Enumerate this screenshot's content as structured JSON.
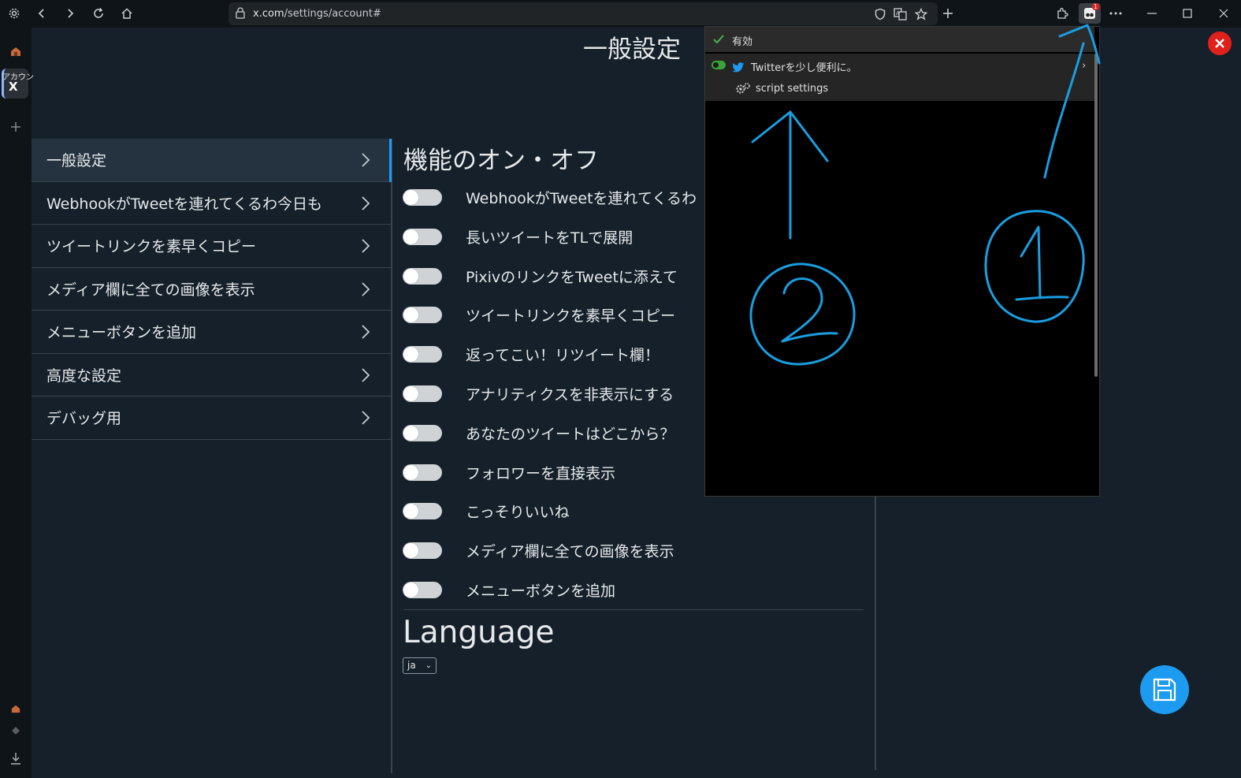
{
  "browser": {
    "url_host": "x.com",
    "url_path": "/settings/account#",
    "extension_badge": "1"
  },
  "sidebar": {
    "account_label": "アカウン",
    "account_icon": "X"
  },
  "page": {
    "title": "一般設定",
    "nav": [
      {
        "label": "一般設定"
      },
      {
        "label": "WebhookがTweetを連れてくるわ今日も"
      },
      {
        "label": "ツイートリンクを素早くコピー"
      },
      {
        "label": "メディア欄に全ての画像を表示"
      },
      {
        "label": "メニューボタンを追加"
      },
      {
        "label": "高度な設定"
      },
      {
        "label": "デバッグ用"
      }
    ],
    "section_title": "機能のオン・オフ",
    "toggles": [
      {
        "label": "WebhookがTweetを連れてくるわ"
      },
      {
        "label": "長いツイートをTLで展開"
      },
      {
        "label": "PixivのリンクをTweetに添えて"
      },
      {
        "label": "ツイートリンクを素早くコピー"
      },
      {
        "label": "返ってこい！リツイート欄！"
      },
      {
        "label": "アナリティクスを非表示にする"
      },
      {
        "label": "あなたのツイートはどこから？"
      },
      {
        "label": "フォロワーを直接表示"
      },
      {
        "label": "こっそりいいね"
      },
      {
        "label": "メディア欄に全ての画像を表示"
      },
      {
        "label": "メニューボタンを追加"
      }
    ],
    "language_title": "Language",
    "language_value": "ja"
  },
  "popup": {
    "enabled_label": "有効",
    "script_name": "Twitterを少し便利に。",
    "script_settings": "script settings"
  },
  "colors": {
    "accent": "#1d9bf0",
    "annotation": "#1a9ee0",
    "close": "#e0201b"
  },
  "icons": [
    "settings-icon",
    "back-icon",
    "forward-icon",
    "reload-icon",
    "home-icon",
    "lock-icon",
    "shield-icon",
    "translate-icon",
    "star-icon",
    "new-tab-icon",
    "extensions-icon",
    "tampermonkey-icon",
    "more-icon",
    "minimize-icon",
    "maximize-icon",
    "close-window-icon",
    "chevron-right-icon",
    "save-icon",
    "close-icon",
    "twitter-icon",
    "gear-icon",
    "check-icon"
  ]
}
